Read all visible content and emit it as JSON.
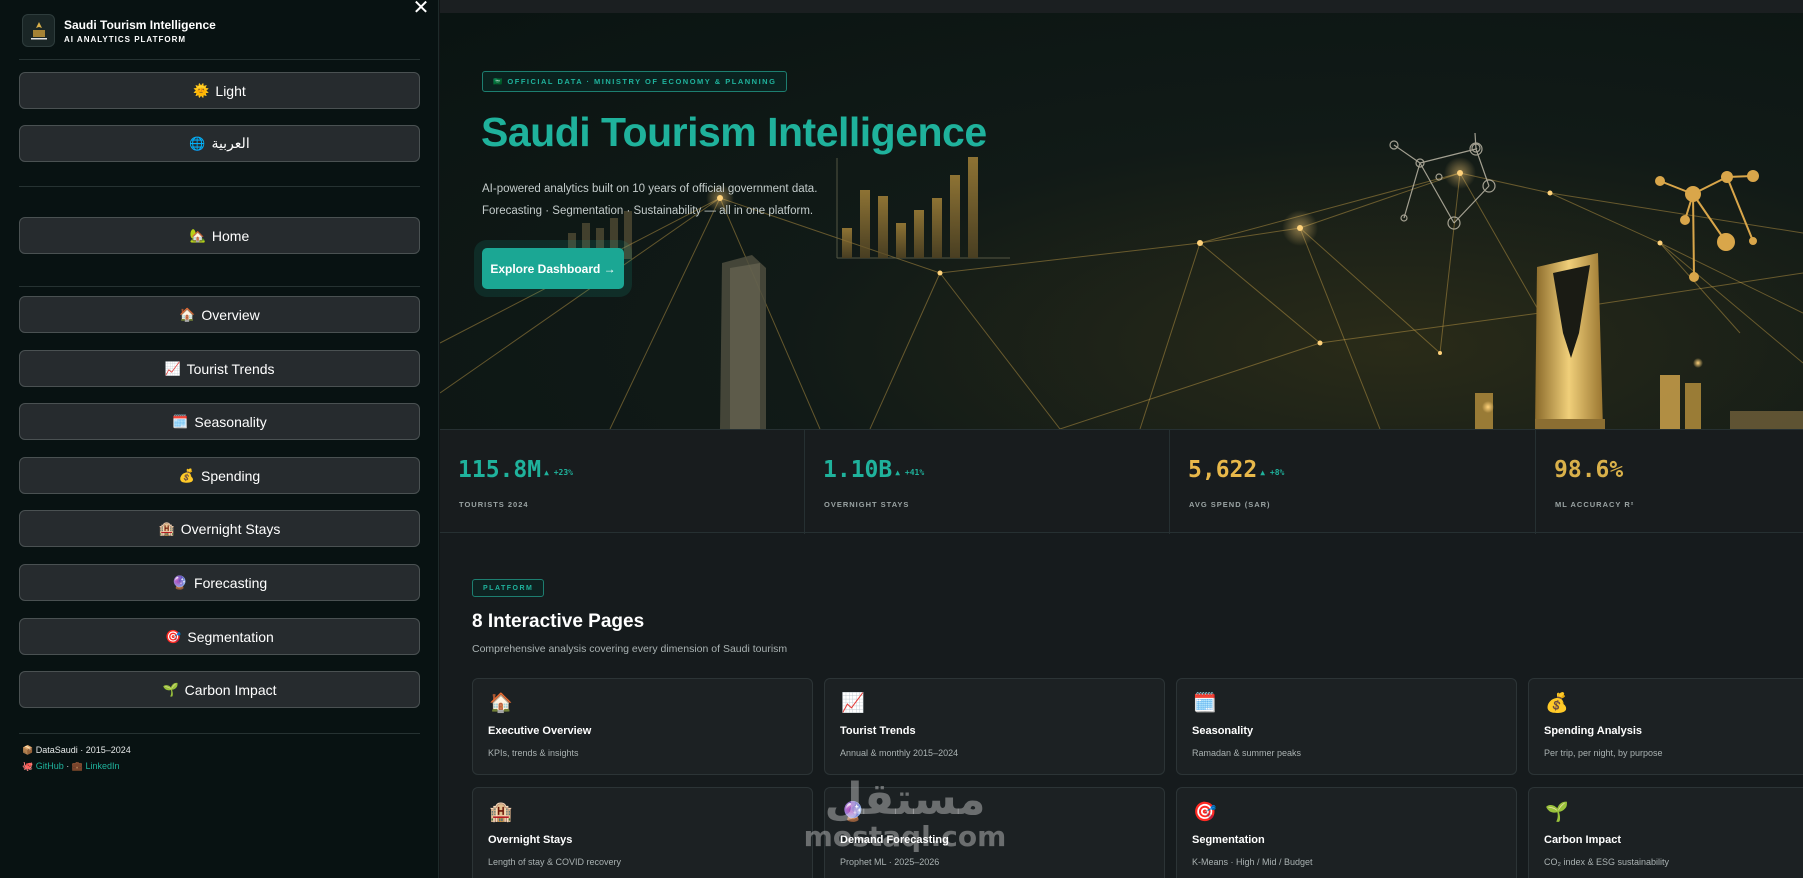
{
  "sidebar": {
    "close_label": "✕",
    "brand_title": "Saudi Tourism Intelligence",
    "brand_subtitle": "AI ANALYTICS PLATFORM",
    "theme_button": {
      "icon": "🌞",
      "label": "Light"
    },
    "language_button": {
      "icon": "🌐",
      "label": "العربية"
    },
    "home_button": {
      "icon": "🏡",
      "label": "Home"
    },
    "nav": [
      {
        "icon": "🏠",
        "label": "Overview"
      },
      {
        "icon": "📈",
        "label": "Tourist Trends"
      },
      {
        "icon": "🗓️",
        "label": "Seasonality"
      },
      {
        "icon": "💰",
        "label": "Spending"
      },
      {
        "icon": "🏨",
        "label": "Overnight Stays"
      },
      {
        "icon": "🔮",
        "label": "Forecasting"
      },
      {
        "icon": "🎯",
        "label": "Segmentation"
      },
      {
        "icon": "🌱",
        "label": "Carbon Impact"
      }
    ],
    "footer_line1": "📦 DataSaudi · 2015–2024",
    "footer_github_icon": "🐙",
    "footer_github": "GitHub",
    "footer_sep": "·",
    "footer_linkedin_icon": "💼",
    "footer_linkedin": "LinkedIn"
  },
  "hero": {
    "badge": "🇸🇦 OFFICIAL DATA · MINISTRY OF ECONOMY & PLANNING",
    "title": "Saudi Tourism Intelligence",
    "desc_line1": "AI-powered analytics built on 10 years of official government data.",
    "desc_line2": "Forecasting · Segmentation · Sustainability — all in one platform.",
    "cta": "Explore Dashboard →"
  },
  "kpis": [
    {
      "value": "115.8M",
      "delta": "▲ +23%",
      "label": "TOURISTS 2024",
      "color": "#1fb29c"
    },
    {
      "value": "1.10B",
      "delta": "▲ +41%",
      "label": "OVERNIGHT STAYS",
      "color": "#1fb29c"
    },
    {
      "value": "5,622",
      "delta": "▲ +8%",
      "label": "AVG SPEND (SAR)",
      "color": "#e8b84a"
    },
    {
      "value": "98.6%",
      "delta": "",
      "label": "ML ACCURACY R²",
      "color": "#d9b04a"
    }
  ],
  "platform": {
    "badge": "PLATFORM",
    "title": "8 Interactive Pages",
    "subtitle": "Comprehensive analysis covering every dimension of Saudi tourism"
  },
  "cards": [
    {
      "icon": "🏠",
      "title": "Executive Overview",
      "desc": "KPIs, trends & insights"
    },
    {
      "icon": "📈",
      "title": "Tourist Trends",
      "desc": "Annual & monthly 2015–2024"
    },
    {
      "icon": "🗓️",
      "title": "Seasonality",
      "desc": "Ramadan & summer peaks"
    },
    {
      "icon": "💰",
      "title": "Spending Analysis",
      "desc": "Per trip, per night, by purpose"
    },
    {
      "icon": "🏨",
      "title": "Overnight Stays",
      "desc": "Length of stay & COVID recovery"
    },
    {
      "icon": "🔮",
      "title": "Demand Forecasting",
      "desc": "Prophet ML · 2025–2026"
    },
    {
      "icon": "🎯",
      "title": "Segmentation",
      "desc": "K-Means · High / Mid / Budget"
    },
    {
      "icon": "🌱",
      "title": "Carbon Impact",
      "desc": "CO₂ index & ESG sustainability"
    }
  ],
  "watermark": {
    "line1": "مستقل",
    "line2": "mostaql.com"
  }
}
